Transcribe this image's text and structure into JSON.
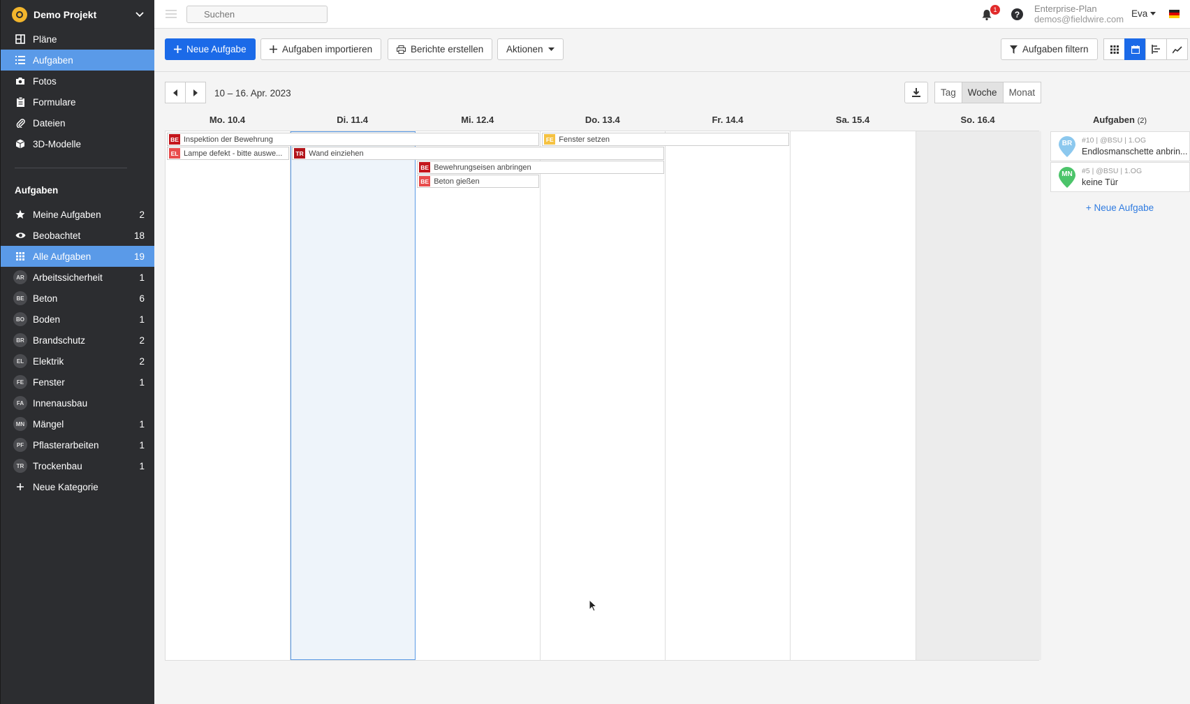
{
  "project": {
    "name": "Demo Projekt"
  },
  "nav": [
    {
      "label": "Pläne",
      "icon": "map-icon"
    },
    {
      "label": "Aufgaben",
      "icon": "list-icon",
      "active": true
    },
    {
      "label": "Fotos",
      "icon": "camera-icon"
    },
    {
      "label": "Formulare",
      "icon": "clipboard-icon"
    },
    {
      "label": "Dateien",
      "icon": "paperclip-icon"
    },
    {
      "label": "3D-Modelle",
      "icon": "cube-icon"
    }
  ],
  "tasks_section": {
    "title": "Aufgaben",
    "filters": [
      {
        "label": "Meine Aufgaben",
        "count": "2",
        "icon": "star-icon"
      },
      {
        "label": "Beobachtet",
        "count": "18",
        "icon": "eye-icon"
      },
      {
        "label": "Alle Aufgaben",
        "count": "19",
        "icon": "grid-icon",
        "active": true
      }
    ],
    "categories": [
      {
        "abbr": "AR",
        "label": "Arbeitssicherheit",
        "count": "1"
      },
      {
        "abbr": "BE",
        "label": "Beton",
        "count": "6"
      },
      {
        "abbr": "BO",
        "label": "Boden",
        "count": "1"
      },
      {
        "abbr": "BR",
        "label": "Brandschutz",
        "count": "2"
      },
      {
        "abbr": "EL",
        "label": "Elektrik",
        "count": "2"
      },
      {
        "abbr": "FE",
        "label": "Fenster",
        "count": "1"
      },
      {
        "abbr": "FA",
        "label": "Innenausbau",
        "count": ""
      },
      {
        "abbr": "MN",
        "label": "Mängel",
        "count": "1"
      },
      {
        "abbr": "PF",
        "label": "Pflasterarbeiten",
        "count": "1"
      },
      {
        "abbr": "TR",
        "label": "Trockenbau",
        "count": "1"
      }
    ],
    "new_category": "Neue Kategorie"
  },
  "topbar": {
    "search_placeholder": "Suchen",
    "notif_count": "1",
    "help": "?",
    "plan_name": "Enterprise-Plan",
    "plan_email": "demos@fieldwire.com",
    "user": "Eva"
  },
  "toolbar": {
    "new_task": "Neue Aufgabe",
    "import_tasks": "Aufgaben importieren",
    "create_reports": "Berichte erstellen",
    "actions": "Aktionen",
    "filter_tasks": "Aufgaben filtern"
  },
  "calendar": {
    "range_label": "10 – 16. Apr. 2023",
    "range_buttons": [
      "Tag",
      "Woche",
      "Monat"
    ],
    "active_range": "Woche",
    "days": [
      "Mo. 10.4",
      "Di. 11.4",
      "Mi. 12.4",
      "Do. 13.4",
      "Fr. 14.4",
      "Sa. 15.4",
      "So. 16.4"
    ],
    "today_index": 1,
    "weekend_index": 6,
    "events": [
      {
        "abbr": "BE",
        "title": "Inspektion der Bewehrung",
        "color": "#c4161c",
        "start": 0,
        "span": 3,
        "row": 0
      },
      {
        "abbr": "FE",
        "title": "Fenster setzen",
        "color": "#f5c242",
        "start": 3,
        "span": 2,
        "row": 0
      },
      {
        "abbr": "EL",
        "title": "Lampe defekt - bitte auswe...",
        "color": "#e84c4c",
        "start": 0,
        "span": 1,
        "row": 1
      },
      {
        "abbr": "TR",
        "title": "Wand einziehen",
        "color": "#b3141a",
        "start": 1,
        "span": 3,
        "row": 1
      },
      {
        "abbr": "BE",
        "title": "Bewehrungseisen anbringen",
        "color": "#c4161c",
        "start": 2,
        "span": 2,
        "row": 2
      },
      {
        "abbr": "BE",
        "title": "Beton gießen",
        "color": "#e84c4c",
        "start": 2,
        "span": 1,
        "row": 3
      }
    ]
  },
  "side_panel": {
    "title": "Aufgaben",
    "count": "(2)",
    "cards": [
      {
        "abbr": "BR",
        "color": "#8cc8ee",
        "meta": "#10 | @BSU | 1.OG",
        "title": "Endlosmanschette anbrin..."
      },
      {
        "abbr": "MN",
        "color": "#4cc46a",
        "meta": "#5 | @BSU | 1.OG",
        "title": "keine Tür"
      }
    ],
    "new_task_link": "+ Neue Aufgabe"
  }
}
